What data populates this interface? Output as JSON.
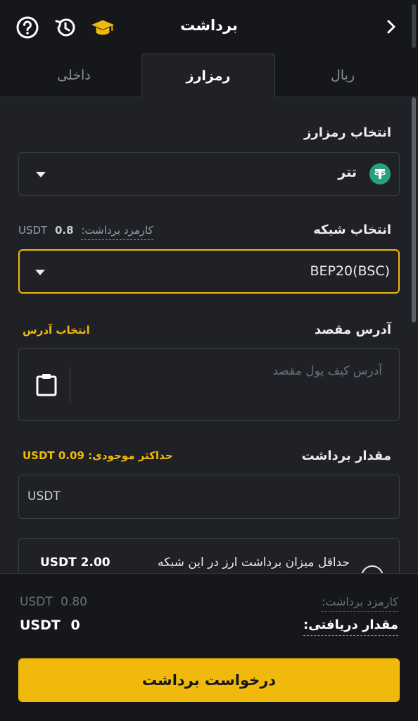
{
  "header": {
    "title": "برداشت"
  },
  "tabs": [
    {
      "label": "ریال"
    },
    {
      "label": "رمزارز"
    },
    {
      "label": "داخلی"
    }
  ],
  "select_crypto": {
    "label": "انتخاب رمزارز",
    "value": "تتر"
  },
  "network": {
    "label": "انتخاب شبکه",
    "fee_label": "کارمزد برداشت:",
    "fee_value": "0.8",
    "fee_unit": "USDT",
    "value": "BEP20(BSC)"
  },
  "address": {
    "label": "آدرس مقصد",
    "choose_link": "انتخاب آدرس",
    "placeholder": "آدرس کیف پول مقصد"
  },
  "amount": {
    "label": "مقدار برداشت",
    "max_label": "حداکثر موجودی:",
    "max_value": "USDT 0.09",
    "unit": "USDT"
  },
  "info": {
    "text": "حداقل میزان برداشت ارز در این شبکه",
    "min_value": "USDT 2.00"
  },
  "summary": {
    "fee_label": "کارمزد برداشت:",
    "fee_value": "0.80",
    "fee_unit": "USDT",
    "receive_label": "مقدار دریافتی:",
    "receive_value": "0",
    "receive_unit": "USDT"
  },
  "submit_label": "درخواست برداشت",
  "colors": {
    "accent": "#f0b90b",
    "background": "#1f2126",
    "header": "#15171a",
    "tether": "#26a17b"
  }
}
